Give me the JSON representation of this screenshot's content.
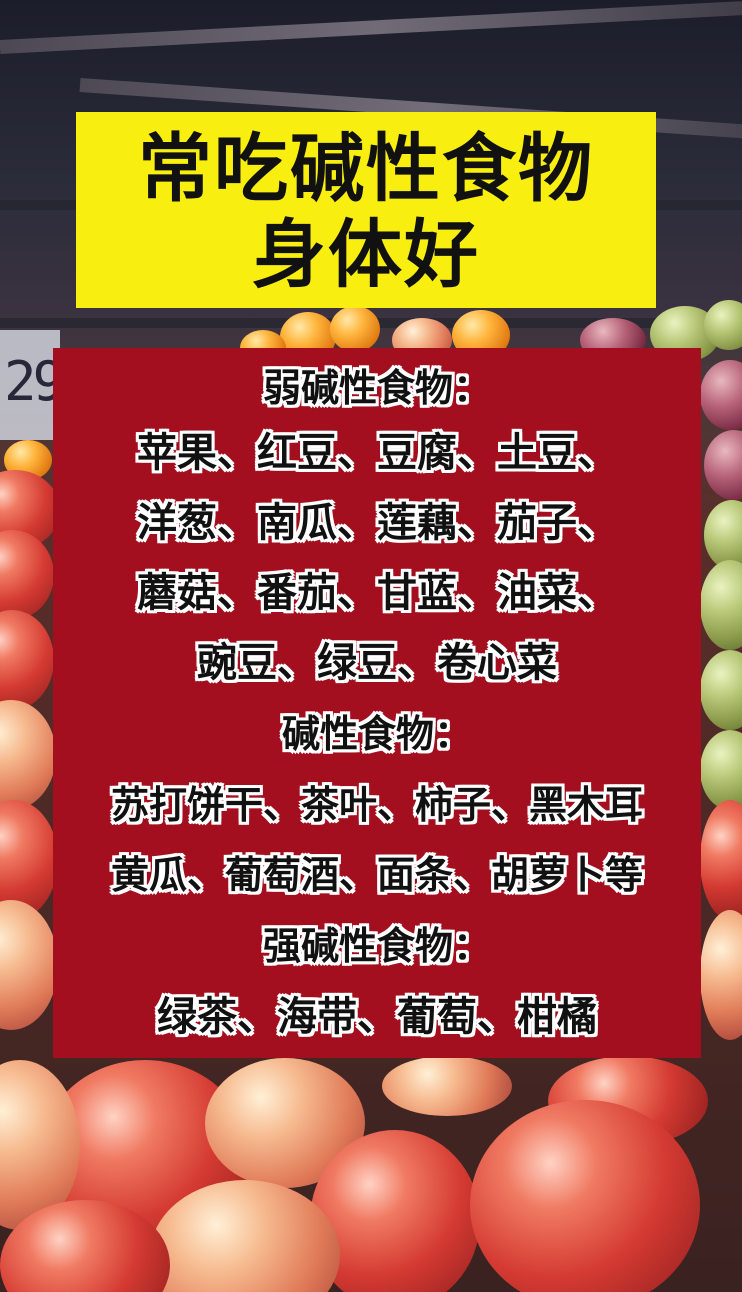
{
  "title": {
    "line1": "常吃碱性食物",
    "line2": "身体好"
  },
  "sections": [
    {
      "heading": "弱碱性食物：",
      "lines": [
        "苹果、红豆、豆腐、土豆、",
        "洋葱、南瓜、莲藕、茄子、",
        "蘑菇、番茄、甘蓝、油菜、",
        "豌豆、绿豆、卷心菜"
      ]
    },
    {
      "heading": "碱性食物：",
      "lines": [
        "苏打饼干、茶叶、柿子、黑木耳",
        "黄瓜、葡萄酒、面条、胡萝卜等"
      ]
    },
    {
      "heading": "强碱性食物：",
      "lines": [
        "绿茶、海带、葡萄、柑橘"
      ]
    }
  ],
  "colors": {
    "banner": "#f8ef10",
    "card": "#a30f1e",
    "text": "#111111",
    "outline": "#ffffff"
  }
}
